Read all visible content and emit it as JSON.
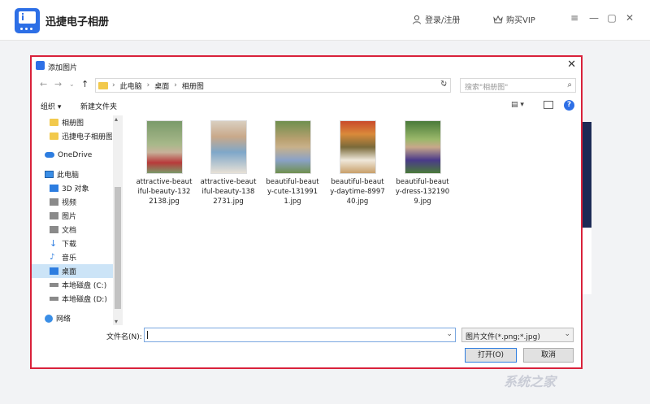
{
  "app": {
    "title": "迅捷电子相册",
    "login": "登录/注册",
    "vip": "购买VIP"
  },
  "dialog": {
    "title": "添加图片",
    "breadcrumb": [
      "此电脑",
      "桌面",
      "相册图"
    ],
    "search_placeholder": "搜索\"相册图\"",
    "toolbar": {
      "organize": "组织 ▾",
      "new_folder": "新建文件夹"
    },
    "nav": [
      {
        "label": "相册图",
        "icon": "folder-icon"
      },
      {
        "label": "迅捷电子相册图",
        "icon": "folder-icon"
      },
      {
        "label": "OneDrive",
        "icon": "cloud-icon"
      },
      {
        "label": "此电脑",
        "icon": "computer-icon"
      },
      {
        "label": "3D 对象",
        "icon": "cube-icon"
      },
      {
        "label": "视频",
        "icon": "video-icon"
      },
      {
        "label": "图片",
        "icon": "picture-icon"
      },
      {
        "label": "文档",
        "icon": "document-icon"
      },
      {
        "label": "下载",
        "icon": "download-icon"
      },
      {
        "label": "音乐",
        "icon": "music-icon"
      },
      {
        "label": "桌面",
        "icon": "desktop-icon",
        "selected": true
      },
      {
        "label": "本地磁盘 (C:)",
        "icon": "drive-icon"
      },
      {
        "label": "本地磁盘 (D:)",
        "icon": "drive-icon"
      },
      {
        "label": "网络",
        "icon": "network-icon"
      }
    ],
    "files": [
      {
        "name": "attractive-beautiful-beauty-1322138.jpg",
        "colors": [
          "#7a9a6a",
          "#c7b29a",
          "#b83a3a"
        ]
      },
      {
        "name": "attractive-beautiful-beauty-1382731.jpg",
        "colors": [
          "#d9cfc0",
          "#7fa7c9",
          "#e7e1d6"
        ]
      },
      {
        "name": "beautiful-beauty-cute-1319911.jpg",
        "colors": [
          "#6f8f4e",
          "#c8b18a",
          "#8aa2c7"
        ]
      },
      {
        "name": "beautiful-beauty-daytime-899740.jpg",
        "colors": [
          "#c94a2a",
          "#7a6a3a",
          "#efe8da"
        ]
      },
      {
        "name": "beautiful-beauty-dress-1321909.jpg",
        "colors": [
          "#4a7a3a",
          "#9ab86a",
          "#4a3a8a"
        ]
      }
    ],
    "filename_label": "文件名(N):",
    "filename_value": "",
    "filetype": "图片文件(*.png;*.jpg)",
    "open_button": "打开(O)",
    "cancel_button": "取消"
  },
  "watermark": "系统之家"
}
